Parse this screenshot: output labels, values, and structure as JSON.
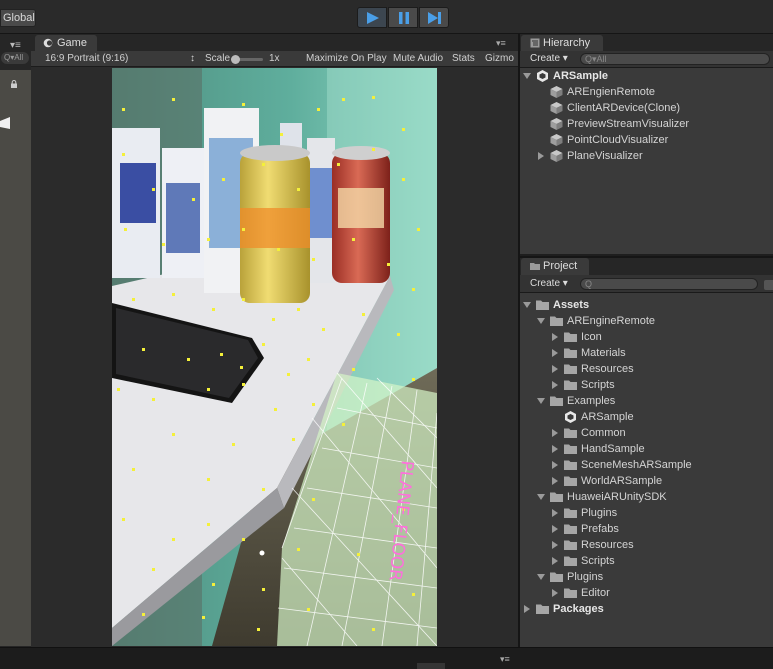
{
  "toolbar": {
    "global_label": "Global",
    "play_icon": "play-icon",
    "pause_icon": "pause-icon",
    "step_icon": "step-icon",
    "accent": "#4a9fe8"
  },
  "scene": {
    "menu": "▾≡",
    "search_placeholder": "Q▾All"
  },
  "game": {
    "tab_label": "Game",
    "panel_menu": "▾≡",
    "aspect": "16:9 Portrait (9:16)",
    "aspect_arrow": "↕",
    "scale_label": "Scale",
    "scale_value": "1x",
    "maximize": "Maximize On Play",
    "mute": "Mute Audio",
    "stats": "Stats",
    "gizmos": "Gizmo",
    "overlay_label": "PLANE_FLOOR",
    "overlay_color": "#ff6fdc",
    "point_color": "#f4f03a"
  },
  "hierarchy": {
    "tab_label": "Hierarchy",
    "create_label": "Create ▾",
    "search_placeholder": "Q▾All",
    "root": "ARSample",
    "items": [
      "AREngienRemote",
      "ClientARDevice(Clone)",
      "PreviewStreamVisualizer",
      "PointCloudVisualizer",
      "PlaneVisualizer"
    ]
  },
  "project": {
    "tab_label": "Project",
    "create_label": "Create ▾",
    "search_placeholder": "Q",
    "tree": [
      {
        "label": "Assets",
        "level": 0,
        "expanded": true,
        "bold": true,
        "icon": "folder"
      },
      {
        "label": "AREngineRemote",
        "level": 1,
        "expanded": true,
        "icon": "folder"
      },
      {
        "label": "Icon",
        "level": 2,
        "expanded": false,
        "icon": "folder"
      },
      {
        "label": "Materials",
        "level": 2,
        "expanded": false,
        "icon": "folder"
      },
      {
        "label": "Resources",
        "level": 2,
        "expanded": false,
        "icon": "folder"
      },
      {
        "label": "Scripts",
        "level": 2,
        "expanded": false,
        "icon": "folder"
      },
      {
        "label": "Examples",
        "level": 1,
        "expanded": true,
        "icon": "folder"
      },
      {
        "label": "ARSample",
        "level": 2,
        "expanded": null,
        "icon": "unity-scene"
      },
      {
        "label": "Common",
        "level": 2,
        "expanded": false,
        "icon": "folder"
      },
      {
        "label": "HandSample",
        "level": 2,
        "expanded": false,
        "icon": "folder"
      },
      {
        "label": "SceneMeshARSample",
        "level": 2,
        "expanded": false,
        "icon": "folder"
      },
      {
        "label": "WorldARSample",
        "level": 2,
        "expanded": false,
        "icon": "folder"
      },
      {
        "label": "HuaweiARUnitySDK",
        "level": 1,
        "expanded": true,
        "icon": "folder"
      },
      {
        "label": "Plugins",
        "level": 2,
        "expanded": false,
        "icon": "folder"
      },
      {
        "label": "Prefabs",
        "level": 2,
        "expanded": false,
        "icon": "folder"
      },
      {
        "label": "Resources",
        "level": 2,
        "expanded": false,
        "icon": "folder"
      },
      {
        "label": "Scripts",
        "level": 2,
        "expanded": false,
        "icon": "folder"
      },
      {
        "label": "Plugins",
        "level": 1,
        "expanded": true,
        "icon": "folder"
      },
      {
        "label": "Editor",
        "level": 2,
        "expanded": false,
        "icon": "folder"
      },
      {
        "label": "Packages",
        "level": 0,
        "expanded": false,
        "bold": true,
        "icon": "folder"
      }
    ]
  },
  "footer": {
    "menu": "▾≡"
  }
}
